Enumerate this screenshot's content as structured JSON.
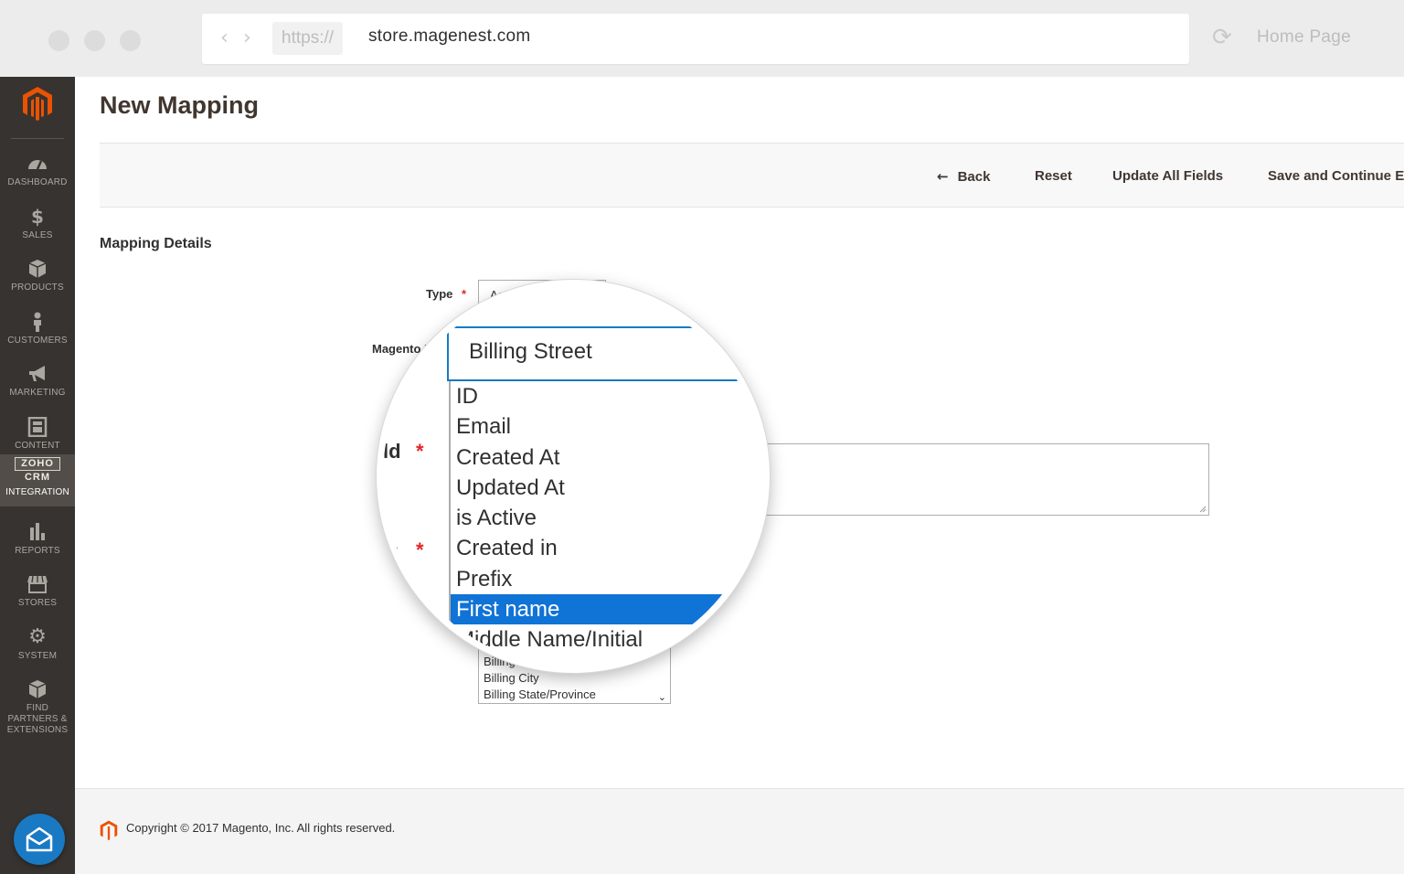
{
  "browser": {
    "protocol": "https://",
    "domain": "store.magenest.com",
    "home_label": "Home Page"
  },
  "sidebar": {
    "items": [
      {
        "label": "DASHBOARD",
        "icon": "dashboard-icon"
      },
      {
        "label": "SALES",
        "icon": "dollar-icon"
      },
      {
        "label": "PRODUCTS",
        "icon": "box-icon"
      },
      {
        "label": "CUSTOMERS",
        "icon": "person-icon"
      },
      {
        "label": "MARKETING",
        "icon": "megaphone-icon"
      },
      {
        "label": "CONTENT",
        "icon": "layout-icon"
      },
      {
        "label": "INTEGRATION",
        "icon": "zoho-crm-logo"
      },
      {
        "label": "REPORTS",
        "icon": "bar-chart-icon"
      },
      {
        "label": "STORES",
        "icon": "store-icon"
      },
      {
        "label": "SYSTEM",
        "icon": "gear-icon"
      },
      {
        "label": "FIND PARTNERS & EXTENSIONS",
        "icon": "cube-icon"
      }
    ],
    "active": "INTEGRATION",
    "zoho_text_1": "ZOHO",
    "zoho_text_2": "CRM"
  },
  "page": {
    "title": "New Mapping"
  },
  "actions": {
    "back": "Back",
    "reset": "Reset",
    "update_all": "Update All Fields",
    "save_continue": "Save and Continue E"
  },
  "form": {
    "section_title": "Mapping Details",
    "type_label": "Type",
    "type_value": "Accou",
    "magento_field_label": "Magento Fi",
    "listbox_options": [
      "Billing Sta",
      "Billing City",
      "Billing State/Province"
    ]
  },
  "magnifier": {
    "selected_value": "Billing Street",
    "label_1": "ld",
    "label_2": "n",
    "options": [
      "ID",
      "Email",
      "Created At",
      "Updated At",
      "is Active",
      "Created in",
      "Prefix",
      "First name",
      "Middle Name/Initial"
    ],
    "highlighted": "First name"
  },
  "footer": {
    "copyright": "Copyright © 2017 Magento, Inc. All rights reserved."
  },
  "colors": {
    "sidebar_bg": "#373330",
    "accent_orange": "#eb5202",
    "selection_blue": "#1073d6",
    "required_red": "#e22626"
  }
}
